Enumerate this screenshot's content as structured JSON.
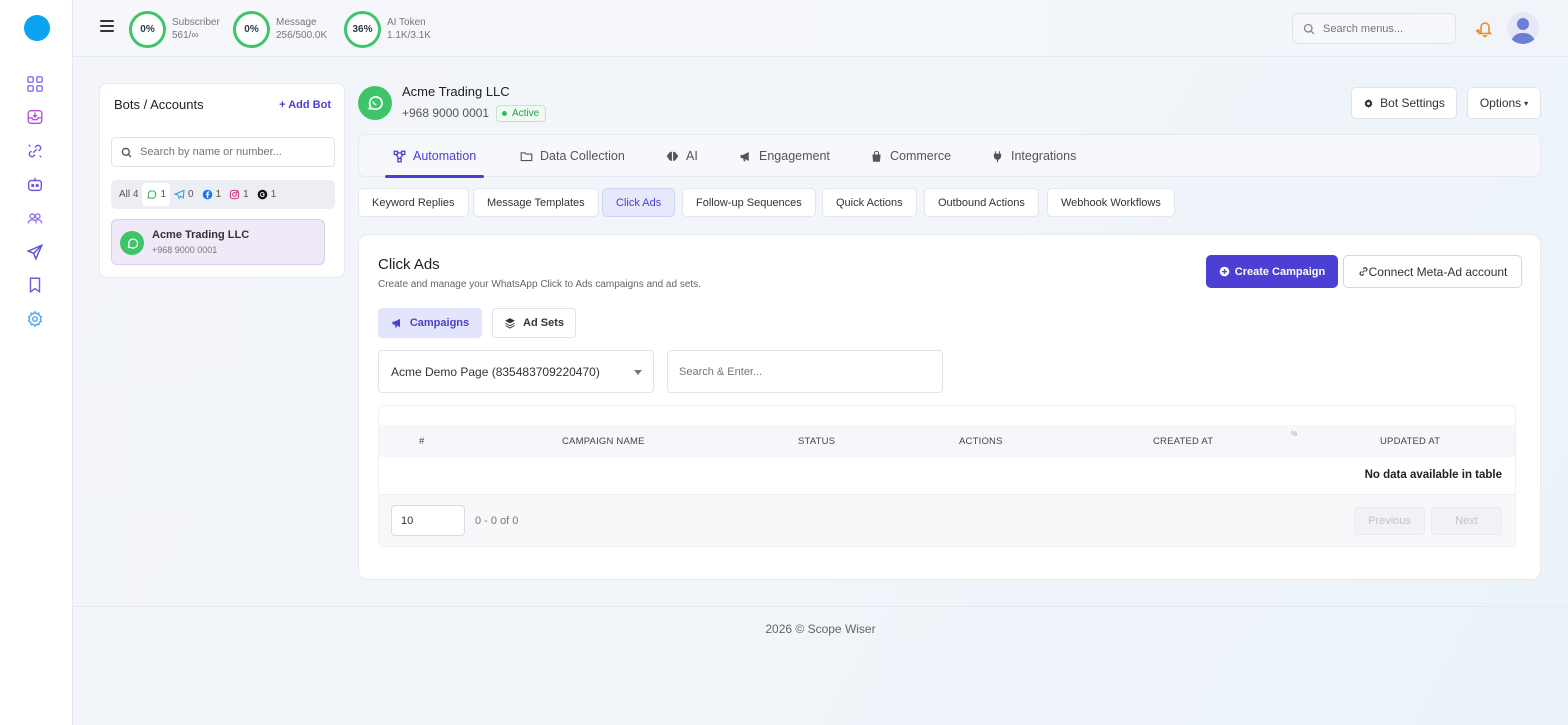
{
  "topbar": {
    "stats": [
      {
        "percent": "0%",
        "label": "Subscriber",
        "value": "561/∞"
      },
      {
        "percent": "0%",
        "label": "Message",
        "value": "256/500.0K"
      },
      {
        "percent": "36%",
        "label": "AI Token",
        "value": "1.1K/3.1K"
      }
    ],
    "search_placeholder": "Search menus..."
  },
  "bots": {
    "title": "Bots / Accounts",
    "add_label": "Add Bot",
    "search_placeholder": "Search by name or number...",
    "filters": [
      {
        "label": "All",
        "count": "4",
        "icon": "all"
      },
      {
        "label": "",
        "count": "1",
        "icon": "whatsapp-icon"
      },
      {
        "label": "",
        "count": "0",
        "icon": "telegram-icon"
      },
      {
        "label": "",
        "count": "1",
        "icon": "facebook-icon"
      },
      {
        "label": "",
        "count": "1",
        "icon": "instagram-icon"
      },
      {
        "label": "",
        "count": "1",
        "icon": "threads-icon"
      }
    ],
    "items": [
      {
        "name": "Acme Trading LLC",
        "phone": "+968 9000 0001"
      }
    ]
  },
  "account": {
    "name": "Acme Trading LLC",
    "phone": "+968 9000 0001",
    "status": "Active",
    "bot_settings_label": "Bot Settings",
    "options_label": "Options"
  },
  "main_tabs": [
    {
      "label": "Automation",
      "icon": "automation-icon",
      "active": true
    },
    {
      "label": "Data Collection",
      "icon": "folder-icon",
      "active": false
    },
    {
      "label": "AI",
      "icon": "brain-icon",
      "active": false
    },
    {
      "label": "Engagement",
      "icon": "megaphone-icon",
      "active": false
    },
    {
      "label": "Commerce",
      "icon": "bag-icon",
      "active": false
    },
    {
      "label": "Integrations",
      "icon": "plug-icon",
      "active": false
    }
  ],
  "sub_tabs": [
    {
      "label": "Keyword Replies",
      "active": false
    },
    {
      "label": "Message Templates",
      "active": false
    },
    {
      "label": "Click Ads",
      "active": true
    },
    {
      "label": "Follow-up Sequences",
      "active": false
    },
    {
      "label": "Quick Actions",
      "active": false
    },
    {
      "label": "Outbound Actions",
      "active": false
    },
    {
      "label": "Webhook Workflows",
      "active": false
    }
  ],
  "click_ads": {
    "title": "Click Ads",
    "subtitle": "Create and manage your WhatsApp Click to Ads campaigns and ad sets.",
    "create_label": "Create Campaign",
    "connect_label": "Connect Meta-Ad account",
    "segments": [
      {
        "label": "Campaigns",
        "active": true
      },
      {
        "label": "Ad Sets",
        "active": false
      }
    ],
    "page_select_value": "Acme Demo Page (835483709220470)",
    "search_placeholder": "Search & Enter...",
    "table": {
      "columns": [
        "#",
        "CAMPAIGN NAME",
        "STATUS",
        "ACTIONS",
        "CREATED AT",
        "UPDATED AT"
      ],
      "sort_hint": "%",
      "empty_text": "No data available in table",
      "page_size": "10",
      "range_text": "0 - 0 of 0",
      "previous_label": "Previous",
      "next_label": "Next"
    }
  },
  "footer": {
    "text": "2026 © Scope Wiser"
  },
  "colors": {
    "accent": "#4b3fd4",
    "whatsapp": "#3fc46a",
    "logo": "#0aa3ef"
  }
}
